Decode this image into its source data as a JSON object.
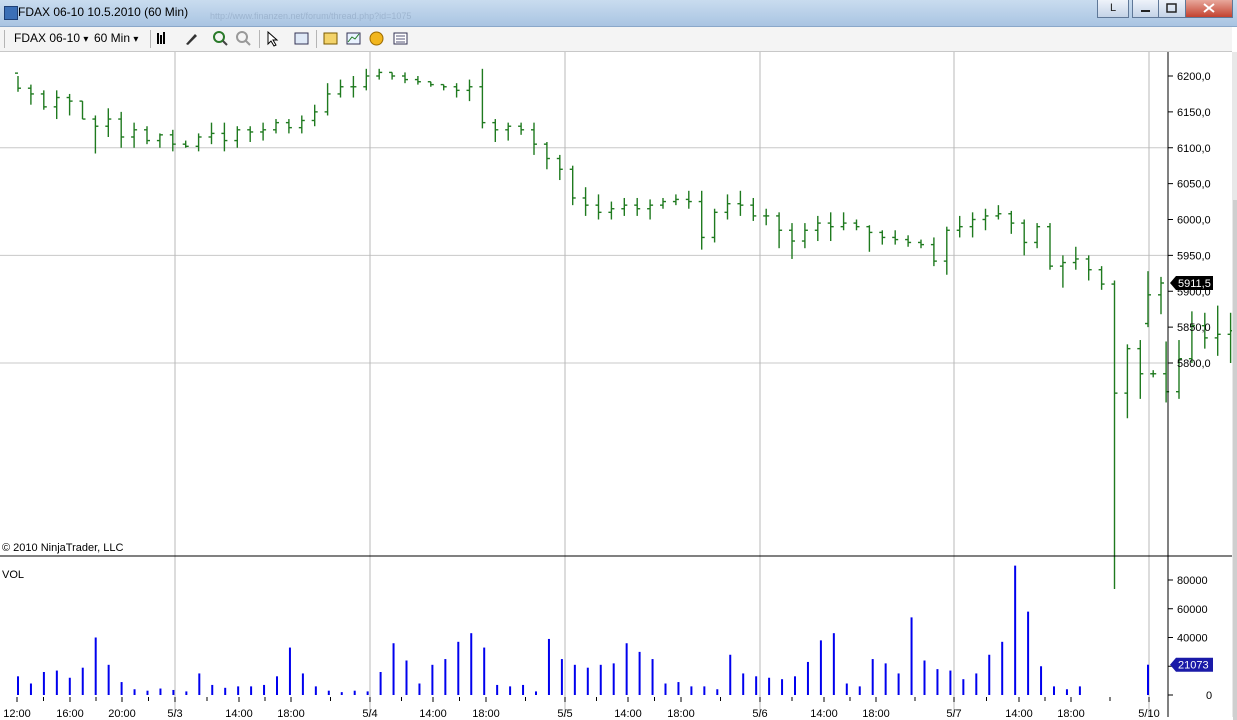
{
  "window": {
    "title": "FDAX 06-10  10.5.2010 (60 Min)",
    "url_ghost": "http://www.finanzen.net/forum/thread.php?id=1075",
    "btn_l": "L",
    "minimize_icon": "minimize-icon",
    "maximize_icon": "maximize-icon",
    "close_icon": "close-icon"
  },
  "toolbar": {
    "instrument": "FDAX 06-10",
    "interval": "60 Min",
    "dropdown_arrow": "▾",
    "icons": [
      "bars-icon",
      "pencil-icon",
      "zoom-in-icon",
      "zoom-out-icon",
      "cursor-icon",
      "properties-icon",
      "strategy-icon",
      "indicator-icon",
      "coin-icon",
      "data-box-icon"
    ]
  },
  "colors": {
    "price_bar": "#1f7a1f",
    "volume_bar": "#0000ee",
    "grid": "#c8c8c8",
    "price_marker": "#000000",
    "volume_marker": "#1a1aa8"
  },
  "chart_data": [
    {
      "type": "ohlc",
      "copyright": "© 2010 NinjaTrader, LLC",
      "yaxis_ticks": [
        "6200,0",
        "6150,0",
        "6100,0",
        "6050,0",
        "6000,0",
        "5950,0",
        "5900,0",
        "5850,0",
        "5800,0"
      ],
      "ylim": [
        5735,
        6215
      ],
      "last_price_label": "5911,5",
      "session_dividers": [
        "5/3",
        "5/4",
        "5/5",
        "5/6",
        "5/7",
        "5/10"
      ],
      "bars": [
        [
          6204,
          6200,
          6178,
          6183
        ],
        [
          6183,
          6188,
          6160,
          6175
        ],
        [
          6175,
          6180,
          6153,
          6157
        ],
        [
          6157,
          6180,
          6140,
          6170
        ],
        [
          6170,
          6175,
          6145,
          6165
        ],
        [
          6165,
          6165,
          6140,
          6140
        ],
        [
          6140,
          6145,
          6092,
          6130
        ],
        [
          6130,
          6155,
          6115,
          6140
        ],
        [
          6140,
          6150,
          6100,
          6115
        ],
        [
          6115,
          6135,
          6100,
          6125
        ],
        [
          6125,
          6130,
          6105,
          6110
        ],
        [
          6110,
          6120,
          6100,
          6118
        ],
        [
          6118,
          6125,
          6095,
          6105
        ],
        [
          6105,
          6110,
          6100,
          6102
        ],
        [
          6102,
          6120,
          6095,
          6115
        ],
        [
          6115,
          6135,
          6105,
          6120
        ],
        [
          6120,
          6135,
          6095,
          6110
        ],
        [
          6110,
          6130,
          6100,
          6125
        ],
        [
          6125,
          6130,
          6108,
          6122
        ],
        [
          6122,
          6135,
          6110,
          6125
        ],
        [
          6125,
          6140,
          6120,
          6135
        ],
        [
          6135,
          6140,
          6120,
          6128
        ],
        [
          6128,
          6145,
          6120,
          6138
        ],
        [
          6138,
          6160,
          6130,
          6150
        ],
        [
          6150,
          6190,
          6145,
          6175
        ],
        [
          6175,
          6195,
          6170,
          6185
        ],
        [
          6185,
          6200,
          6170,
          6185
        ],
        [
          6185,
          6210,
          6180,
          6200
        ],
        [
          6200,
          6210,
          6195,
          6205
        ],
        [
          6205,
          6205,
          6195,
          6200
        ],
        [
          6200,
          6205,
          6190,
          6195
        ],
        [
          6195,
          6200,
          6188,
          6192
        ],
        [
          6192,
          6192,
          6185,
          6188
        ],
        [
          6188,
          6188,
          6180,
          6185
        ],
        [
          6185,
          6190,
          6170,
          6180
        ],
        [
          6180,
          6195,
          6165,
          6185
        ],
        [
          6185,
          6210,
          6127,
          6135
        ],
        [
          6135,
          6140,
          6108,
          6125
        ],
        [
          6125,
          6135,
          6110,
          6130
        ],
        [
          6130,
          6135,
          6118,
          6125
        ],
        [
          6125,
          6135,
          6090,
          6105
        ],
        [
          6105,
          6108,
          6070,
          6085
        ],
        [
          6085,
          6090,
          6055,
          6070
        ],
        [
          6070,
          6075,
          6020,
          6030
        ],
        [
          6030,
          6045,
          6005,
          6020
        ],
        [
          6020,
          6035,
          6000,
          6010
        ],
        [
          6010,
          6025,
          6000,
          6015
        ],
        [
          6015,
          6030,
          6005,
          6020
        ],
        [
          6020,
          6030,
          6005,
          6015
        ],
        [
          6015,
          6028,
          6000,
          6020
        ],
        [
          6020,
          6030,
          6015,
          6025
        ],
        [
          6025,
          6035,
          6020,
          6028
        ],
        [
          6028,
          6040,
          6015,
          6025
        ],
        [
          6025,
          6040,
          5958,
          5975
        ],
        [
          5975,
          6015,
          5968,
          6010
        ],
        [
          6010,
          6035,
          6000,
          6022
        ],
        [
          6022,
          6040,
          6005,
          6020
        ],
        [
          6020,
          6030,
          5998,
          6005
        ],
        [
          6005,
          6015,
          5992,
          6005
        ],
        [
          6005,
          6010,
          5960,
          5985
        ],
        [
          5985,
          5995,
          5945,
          5970
        ],
        [
          5970,
          5995,
          5960,
          5985
        ],
        [
          5985,
          6005,
          5970,
          5995
        ],
        [
          5995,
          6010,
          5970,
          5990
        ],
        [
          5990,
          6010,
          5985,
          5995
        ],
        [
          5995,
          6000,
          5985,
          5990
        ],
        [
          5990,
          5992,
          5955,
          5982
        ],
        [
          5982,
          5985,
          5965,
          5975
        ],
        [
          5975,
          5985,
          5965,
          5972
        ],
        [
          5972,
          5978,
          5962,
          5968
        ],
        [
          5968,
          5972,
          5960,
          5965
        ],
        [
          5965,
          5975,
          5935,
          5942
        ],
        [
          5942,
          5990,
          5923,
          5985
        ],
        [
          5985,
          6005,
          5975,
          5990
        ],
        [
          5990,
          6010,
          5975,
          6000
        ],
        [
          6000,
          6015,
          5985,
          6005
        ],
        [
          6005,
          6020,
          6000,
          6008
        ],
        [
          6008,
          6012,
          5980,
          5995
        ],
        [
          5995,
          6000,
          5950,
          5968
        ],
        [
          5968,
          5995,
          5960,
          5990
        ],
        [
          5990,
          5995,
          5930,
          5935
        ],
        [
          5935,
          5950,
          5905,
          5940
        ],
        [
          5940,
          5962,
          5930,
          5945
        ],
        [
          5945,
          5950,
          5915,
          5930
        ],
        [
          5930,
          5935,
          5902,
          5910
        ],
        [
          5910,
          5915,
          5485,
          5758
        ],
        [
          5758,
          5826,
          5723,
          5820
        ],
        [
          5820,
          5832,
          5750,
          5785
        ],
        [
          5785,
          5790,
          5780,
          5785
        ],
        [
          5785,
          5830,
          5745,
          5760
        ],
        [
          5760,
          5832,
          5750,
          5806
        ],
        [
          5806,
          5872,
          5800,
          5852
        ],
        [
          5852,
          5870,
          5820,
          5835
        ],
        [
          5835,
          5880,
          5810,
          5840
        ],
        [
          5840,
          5870,
          5800,
          5845
        ],
        [
          5845,
          5890,
          5835,
          5880
        ],
        [
          5880,
          5892,
          5840,
          5850
        ],
        [
          5850,
          5895,
          5835,
          5860
        ],
        [
          5860,
          5910,
          5840,
          5880
        ],
        [
          5880,
          5888,
          5818,
          5825
        ],
        [
          5825,
          5835,
          5685,
          5725
        ],
        [
          5725,
          5810,
          5705,
          5745
        ],
        [
          5745,
          5780,
          5720,
          5755
        ],
        [
          5755,
          5772,
          5710,
          5730
        ],
        [
          5730,
          5762,
          5715,
          5742
        ],
        [
          5742,
          5750,
          5718,
          5735
        ],
        [
          5735,
          5750,
          5700,
          5740
        ],
        [
          5740,
          5748,
          5720,
          5730
        ],
        [
          5855,
          5928,
          5850,
          5895
        ],
        [
          5895,
          5920,
          5868,
          5911.5
        ]
      ]
    },
    {
      "type": "bar",
      "label": "VOL",
      "yaxis_ticks": [
        "80000",
        "60000",
        "40000",
        "20000",
        "0"
      ],
      "ylim": [
        0,
        90000
      ],
      "last_value_label": "21073",
      "values": [
        13000,
        8000,
        16000,
        17000,
        12000,
        19000,
        40000,
        21000,
        9000,
        4000,
        3000,
        4500,
        3500,
        2500,
        15000,
        7000,
        5000,
        6000,
        6000,
        7000,
        13000,
        33000,
        15000,
        6000,
        3000,
        2000,
        3000,
        2500,
        16000,
        36000,
        24000,
        8000,
        21000,
        25000,
        37000,
        43000,
        33000,
        7000,
        6000,
        7000,
        2500,
        39000,
        25000,
        21000,
        19000,
        21000,
        22000,
        36000,
        30000,
        25000,
        8000,
        9000,
        6000,
        6000,
        4000,
        28000,
        15000,
        13000,
        12000,
        11000,
        13000,
        23000,
        38000,
        43000,
        8000,
        6000,
        25000,
        22000,
        15000,
        54000,
        24000,
        18000,
        17000,
        11000,
        15000,
        28000,
        37000,
        90000,
        58000,
        20000,
        6000,
        4000,
        6000,
        21073
      ]
    }
  ],
  "xaxis_labels": [
    "12:00",
    "16:00",
    "20:00",
    "5/3",
    "14:00",
    "18:00",
    "5/4",
    "14:00",
    "18:00",
    "5/5",
    "14:00",
    "18:00",
    "5/6",
    "14:00",
    "18:00",
    "5/7",
    "14:00",
    "18:00",
    "5/10"
  ]
}
